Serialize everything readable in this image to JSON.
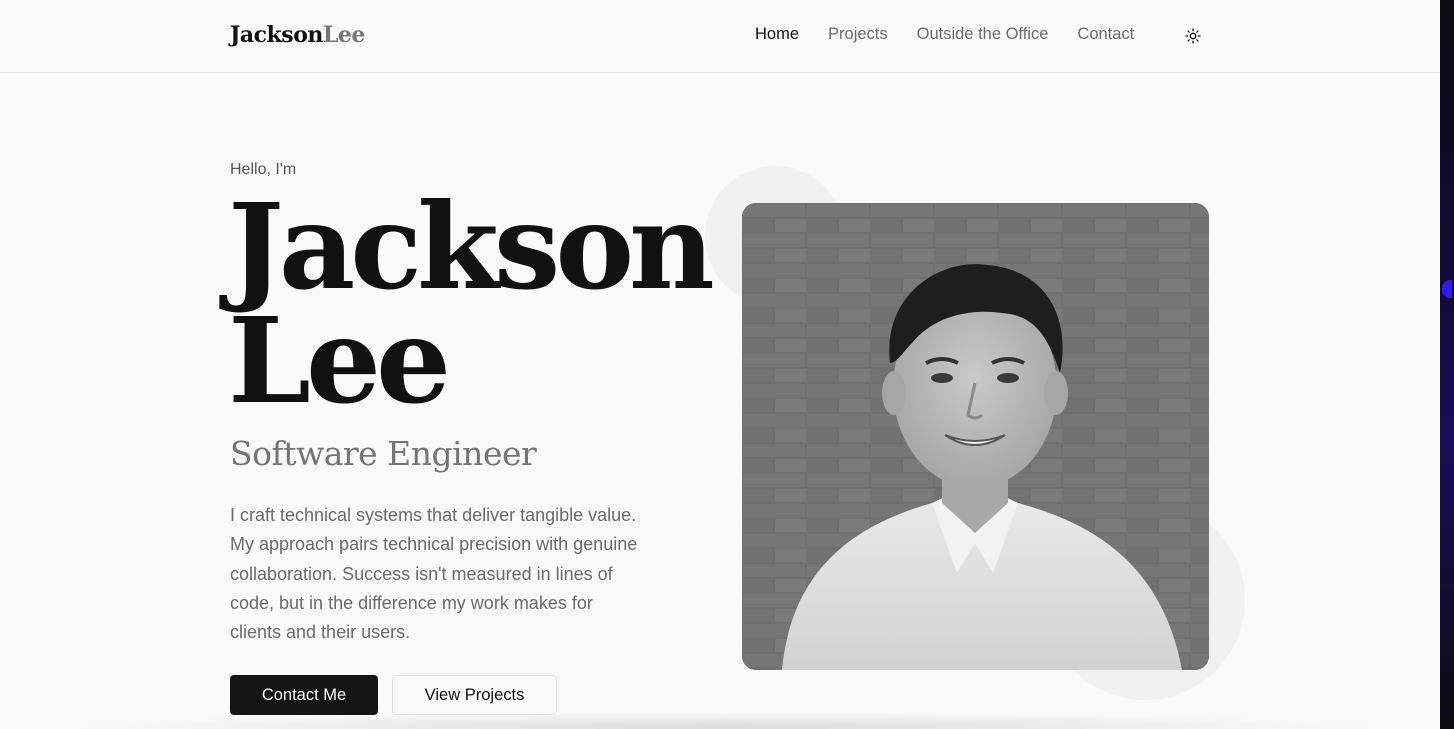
{
  "header": {
    "logo_first": "Jackson",
    "logo_last": "Lee",
    "nav": [
      {
        "label": "Home",
        "active": true
      },
      {
        "label": "Projects",
        "active": false
      },
      {
        "label": "Outside the Office",
        "active": false
      },
      {
        "label": "Contact",
        "active": false
      }
    ],
    "theme_toggle_icon": "sun-icon"
  },
  "hero": {
    "greeting": "Hello, I'm",
    "first_name": "Jackson",
    "last_name": "Lee",
    "role": "Software Engineer",
    "bio": "I craft technical systems that deliver tangible value. My approach pairs technical precision with genuine collaboration. Success isn't measured in lines of code, but in the difference my work makes for clients and their users.",
    "primary_button": "Contact Me",
    "secondary_button": "View Projects"
  },
  "colors": {
    "background": "#fafafa",
    "text": "#111111",
    "muted": "#6b6b6b",
    "primary_button": "#151515"
  }
}
